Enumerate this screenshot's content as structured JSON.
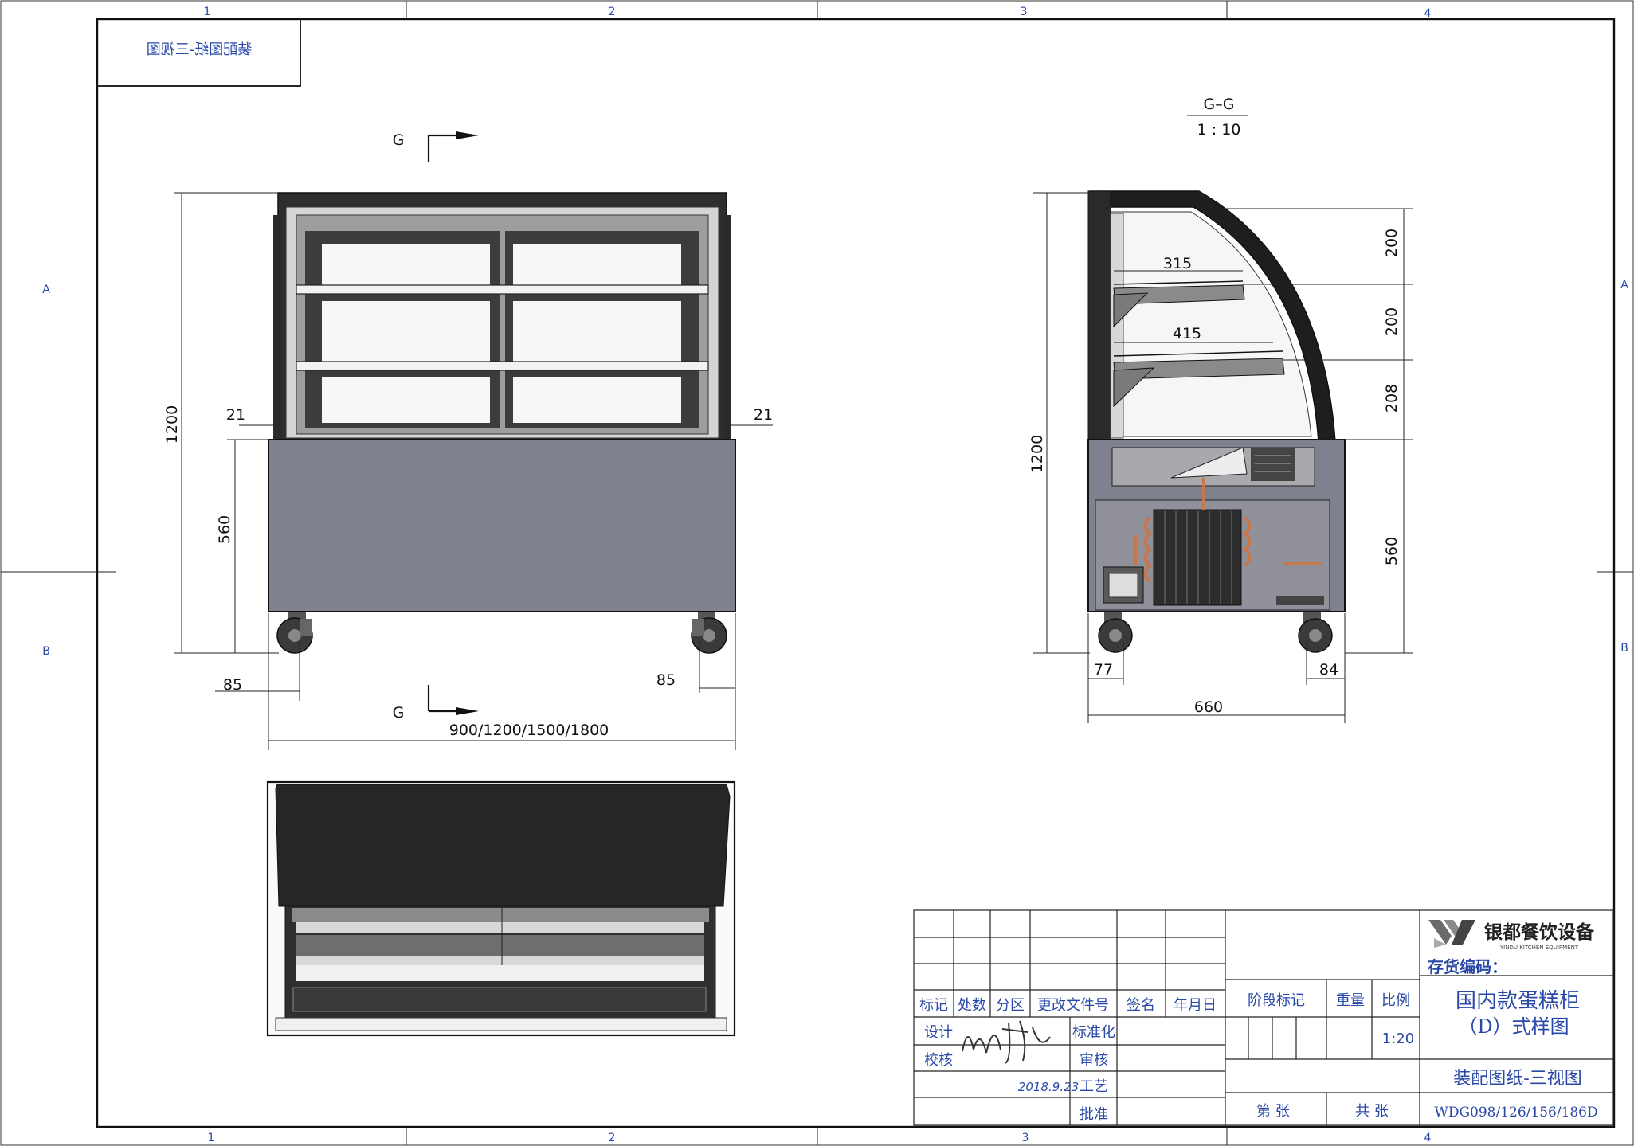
{
  "sheet_title": "装配图纸-三视图",
  "zones": {
    "columns": [
      "1",
      "2",
      "3",
      "4"
    ],
    "rows": [
      "A",
      "B"
    ]
  },
  "section": {
    "marker": "G",
    "label": "G–G",
    "scale": "1 : 10"
  },
  "front_view": {
    "height_total": "1200",
    "base_height": "560",
    "side_offset_left": "21",
    "side_offset_right": "21",
    "caster_offset_left": "85",
    "caster_offset_right": "85",
    "width": "900/1200/1500/1800"
  },
  "side_view": {
    "height_total": "1200",
    "shelf_upper_depth": "315",
    "shelf_lower_depth": "415",
    "spacing_top": "200",
    "spacing_middle": "200",
    "spacing_bottom": "208",
    "base_height": "560",
    "caster_offset_left": "77",
    "caster_offset_right": "84",
    "depth": "660"
  },
  "title_block": {
    "company": "银都餐饮设备",
    "company_en": "YINDU KITCHEN EQUIPMENT",
    "stock_code_label": "存货编码：",
    "product_line1": "国内款蛋糕柜",
    "product_line2": "（D）式样图",
    "drawing_name": "装配图纸-三视图",
    "drawing_number": "WDG098/126/156/186D",
    "rev_headers": [
      "标记",
      "处数",
      "分区",
      "更改文件号",
      "签名",
      "年月日"
    ],
    "roles": [
      "设计",
      "校核"
    ],
    "roles_right": [
      "标准化",
      "审核",
      "工艺",
      "批准"
    ],
    "stage_label": "阶段标记",
    "weight_label": "重量",
    "scale_label": "比例",
    "scale_value": "1:20",
    "sheet_label": "第 张",
    "total_label": "共 张",
    "date": "2018.9.23"
  },
  "colors": {
    "line": "#1a1a1a",
    "zone_text": "#2a48a8",
    "cabinet_base": "#80818e",
    "glass": "#f7f7f7",
    "dark_top": "#2a2a2a",
    "copper": "#c8774a"
  }
}
